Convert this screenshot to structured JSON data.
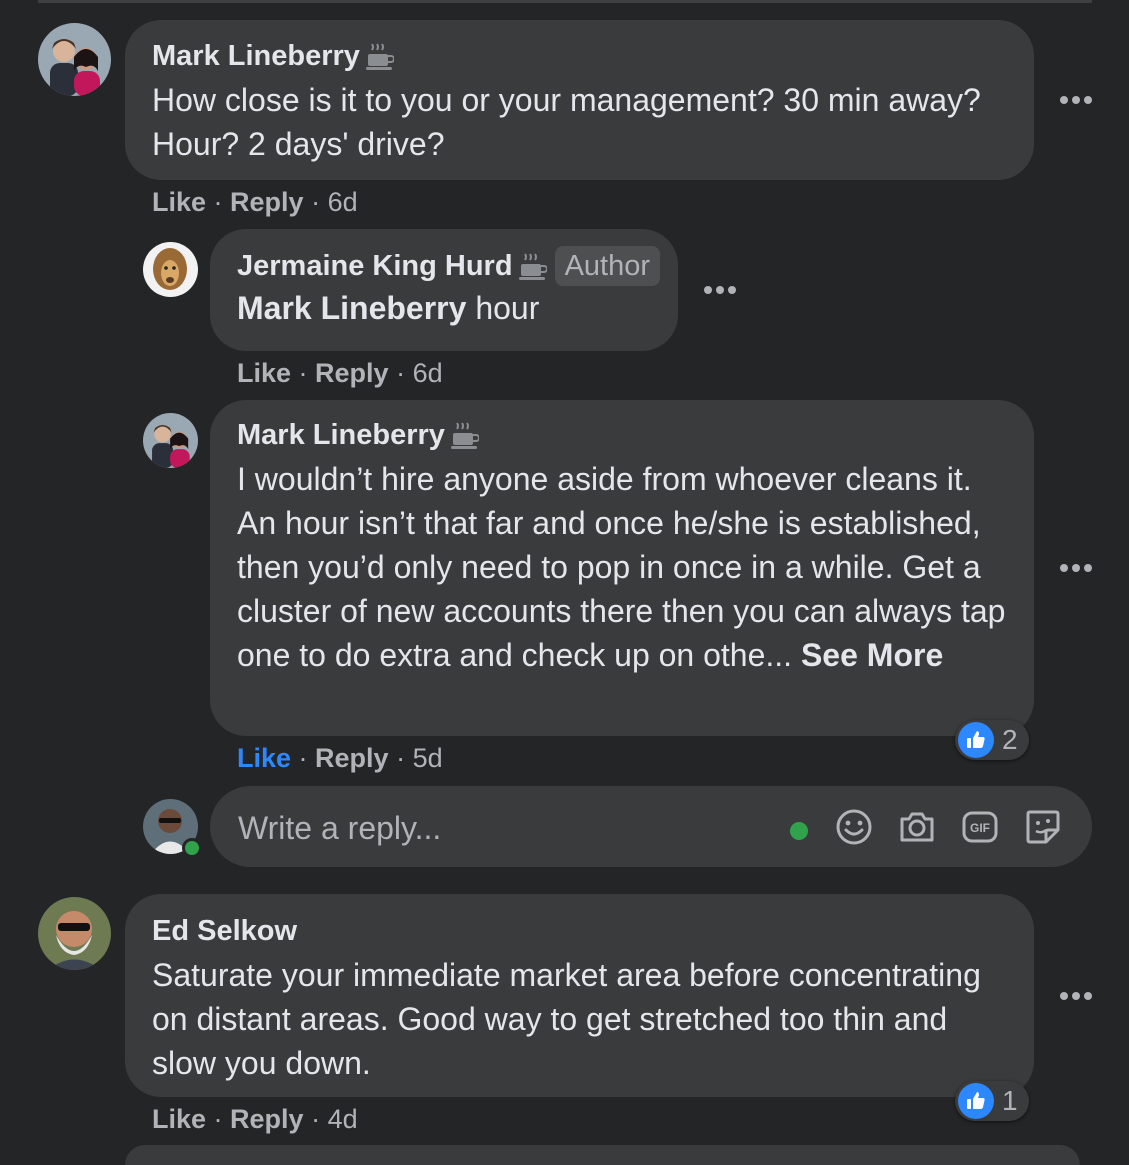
{
  "comments": [
    {
      "author": "Mark Lineberry",
      "text": "How close is it to you or your management? 30 min away? Hour? 2 days' drive?",
      "like_label": "Like",
      "reply_label": "Reply",
      "time": "6d"
    },
    {
      "author": "Jermaine King Hurd",
      "badge": "Author",
      "mention": "Mark Lineberry",
      "text": "hour",
      "like_label": "Like",
      "reply_label": "Reply",
      "time": "6d"
    },
    {
      "author": "Mark Lineberry",
      "text": "I wouldn’t hire anyone aside from whoever cleans it. An hour isn’t that far and once he/she is established, then you’d only need to pop in once in a while. Get a cluster of new accounts there then you can always tap one to do extra and check up on othe...",
      "see_more": "See More",
      "like_label": "Like",
      "reply_label": "Reply",
      "time": "5d",
      "reaction_count": "2",
      "liked": true
    },
    {
      "author": "Ed Selkow",
      "text": "Saturate your immediate market area before concentrating on distant areas. Good way to get stretched too thin and slow you down.",
      "like_label": "Like",
      "reply_label": "Reply",
      "time": "4d",
      "reaction_count": "1"
    }
  ],
  "reply_box": {
    "placeholder": "Write a reply...",
    "icons": [
      "emoji-icon",
      "camera-icon",
      "gif-icon",
      "sticker-icon"
    ]
  },
  "colors": {
    "background": "#242526",
    "bubble": "#3a3b3c",
    "text": "#e4e6eb",
    "secondary_text": "#b0b3b8",
    "accent_blue": "#2d88ff",
    "online_green": "#31a24c"
  }
}
